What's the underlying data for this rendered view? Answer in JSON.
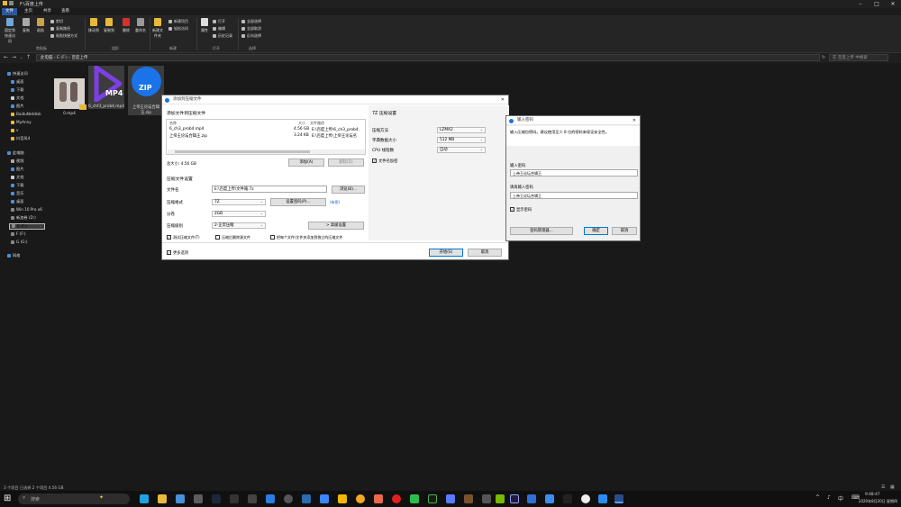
{
  "window": {
    "title": "F:\\百度上传"
  },
  "ribbon_tabs": [
    "文件",
    "主页",
    "共享",
    "查看"
  ],
  "ribbon": {
    "pin_label": "固定到快速访问",
    "copy_label": "复制",
    "paste_label": "粘贴",
    "cut_label": "剪切",
    "copy_path_label": "复制路径",
    "paste_shortcut_label": "粘贴快捷方式",
    "clipboard_group": "剪贴板",
    "move_label": "移动到",
    "copyto_label": "复制到",
    "delete_label": "删除",
    "rename_label": "重命名",
    "organize_group": "组织",
    "newfolder_label": "新建文件夹",
    "newitem_label": "新建项目",
    "easyaccess_label": "轻松访问",
    "new_group": "新建",
    "properties_label": "属性",
    "open_label": "打开",
    "edit_label": "编辑",
    "history_label": "历史记录",
    "open_group": "打开",
    "selectall_label": "全部选择",
    "selectnone_label": "全部取消",
    "invert_label": "反向选择",
    "select_group": "选择"
  },
  "address": {
    "path": "此电脑 › E (F:) › 百度上传",
    "search_placeholder": "在 百度上传 中搜索"
  },
  "nav": [
    "快速访问",
    "桌面",
    "下载",
    "文档",
    "图片",
    "BaiduNetdisk",
    "MyAnny",
    "v",
    "抖音风4",
    "此电脑",
    "视频",
    "图片",
    "文档",
    "下载",
    "音乐",
    "桌面",
    "Win 10 Pro x6",
    "新加卷 (D:)",
    "E (F:)",
    "F (F:)",
    "G (G:)",
    "网络"
  ],
  "files": [
    {
      "name": "0.mp4"
    },
    {
      "name": "6_chf3_prob4.mp4",
      "badge": "MP4"
    },
    {
      "name": "上帝王论坛合辑王.zip",
      "badge": "ZIP"
    }
  ],
  "status": {
    "text": "3 个项目   已选择 2 个项目  4.56 GB"
  },
  "archive_dialog": {
    "title": "添加到压缩文件",
    "files_section": "添加文件到压缩文件",
    "col_name": "名称",
    "col_size": "大小",
    "col_path": "文件路径",
    "rows": [
      {
        "name": "6_ch3_prob4.mp4",
        "size": "4.56 GB",
        "path": "E:\\百度上传\\6_ch3_prob4."
      },
      {
        "name": "上帝王论坛合辑王.zip",
        "size": "3.24 KB",
        "path": "E:\\百度上传\\上帝王论坛名"
      }
    ],
    "total_size": "总大小: 4.56 GB",
    "add_btn": "添加(A)",
    "remove_btn": "删除(D)",
    "settings_section": "压缩文件设置",
    "filename_label": "文件名",
    "filename_value": "E:\\百度上传\\文件箱.7z",
    "browse_btn": "浏览(B)...",
    "format_label": "压缩格式",
    "format_value": "7Z",
    "setpwd_btn": "设置密码(P)...",
    "pwd_status": "(有密)",
    "split_label": "分卷",
    "split_value": "2GB",
    "level_label": "压缩级别",
    "level_value": "2-正常压缩",
    "more_settings_btn": "> 高级设置",
    "test_chk": "测试压缩文件(T)",
    "delete_after_chk": "压缩后删除源文件",
    "each_chk": "把每个文件/文件夹添加到独立的压缩文件",
    "more_options": "更多选项",
    "start_btn": "开始(S)",
    "cancel_btn": "取消",
    "sevenz_section": "7Z 压缩设置",
    "method_label": "压缩方法",
    "method_value": "LZMA2",
    "dict_label": "字典数据大小",
    "dict_value": "512 MB",
    "cpu_label": "CPU 线程数",
    "cpu_value": "自动",
    "encrypt_names": "文件名加密"
  },
  "password_dialog": {
    "title": "输入密码",
    "hint": "输入压缩包密码。建议使用至少 8 位的密码来保证安全性。",
    "enter_label": "输入密码",
    "enter_value": "上帝王论坛合辑王",
    "reenter_label": "请再输入密码",
    "reenter_value": "上帝王论坛合辑王",
    "show_pwd": "显示密码",
    "manager_btn": "密码管理器...",
    "ok_btn": "确定",
    "cancel_btn": "取消"
  },
  "taskbar": {
    "search_placeholder": "搜索",
    "clock_time": "9:48:47",
    "clock_date": "2020年8月20日 星期四",
    "ime": "中"
  },
  "colors": {
    "accent": "#2b579a",
    "zip_blue": "#1a73e8",
    "mp4_purple": "#7b3fe4"
  }
}
